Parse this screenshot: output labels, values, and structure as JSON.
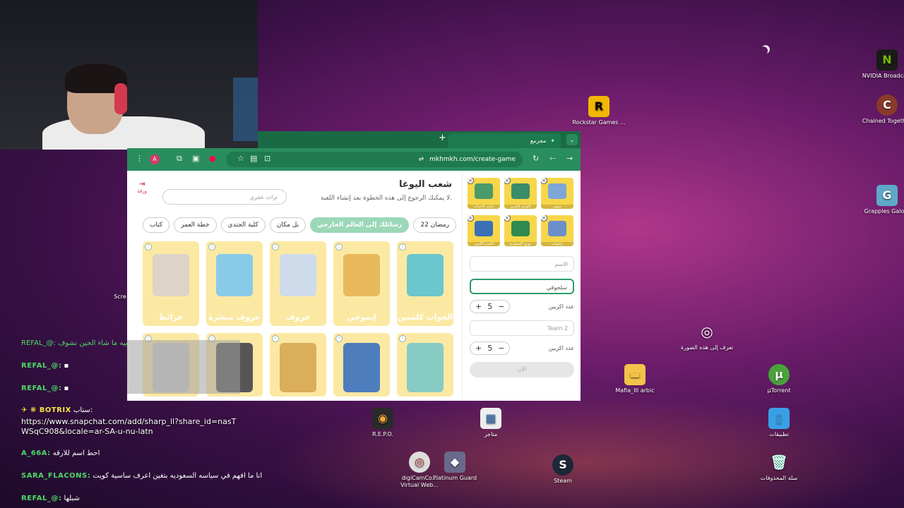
{
  "desktop": {
    "icons": [
      {
        "name": "rockstar",
        "label": "Rockstar Games ...",
        "icon": "R"
      },
      {
        "name": "nvidia",
        "label": "NVIDIA Broadcast",
        "icon": "N"
      },
      {
        "name": "chained",
        "label": "Chained Together",
        "icon": "C"
      },
      {
        "name": "grapples",
        "label": "Grapples Galore",
        "icon": "G"
      },
      {
        "name": "identify",
        "label": "تعرف إلى هذه الصورة",
        "icon": "◎"
      },
      {
        "name": "mafia",
        "label": "Mafia_III arbic",
        "icon": "▬"
      },
      {
        "name": "utorrent",
        "label": "µTorrent",
        "icon": "µ"
      },
      {
        "name": "repo",
        "label": "R.E.P.O.",
        "icon": "◉"
      },
      {
        "name": "store",
        "label": "متاجر",
        "icon": "▦"
      },
      {
        "name": "apps",
        "label": "تطبيقات",
        "icon": "▯"
      },
      {
        "name": "digicam",
        "label": "digiCamCo... Virtual Web...",
        "icon": "◎"
      },
      {
        "name": "platinum",
        "label": "Platinum Guard",
        "icon": "◆"
      },
      {
        "name": "steam",
        "label": "Steam",
        "icon": "S"
      },
      {
        "name": "recycle",
        "label": "سلة المحذوفات",
        "icon": "🗑"
      },
      {
        "name": "scre",
        "label": "Scre",
        "icon": ""
      }
    ]
  },
  "chat": [
    {
      "user": "REFAL_@:",
      "text": "",
      "color": "#4cd964"
    },
    {
      "user": "REFAL_@:",
      "text": "",
      "color": "#4cd964"
    },
    {
      "user": "✈ ❋ BOTRIX",
      "text": "سناب:",
      "color": "#f5e642"
    },
    {
      "user": "A_66A:",
      "text": "احط اسم للارقه",
      "color": "#4cd964"
    },
    {
      "user": "SARA_FLACONS:",
      "text": "انا ما افهم في سياسه السعوديه بتغين اعرف ساسية كويت",
      "color": "#4cd964"
    },
    {
      "user": "REFAL_@:",
      "text": "شبلها",
      "color": "#4cd964"
    }
  ],
  "chat_link": "https://www.snapchat.com/add/sharp_ll?share_id=nasTWSqC908&locale=ar-SA-u-nu-latn",
  "chat_top_text": "REFAL_@: سعوديه حصو هوبيه ما شاء الحين نشوف",
  "browser": {
    "tab_title": "مجرمع",
    "url": "mkhmkh.com/create-game",
    "avatar": "A"
  },
  "page": {
    "title": "شعب اليوغا",
    "subtitle": "لا يمكنك الرجوع إلى هذه الخطوة بعد إنشاء اللعبة.",
    "search_placeholder": "تراث عجري",
    "side_label": "ورقة",
    "chips": [
      "رمضان 22",
      "رسائلك إلى العالم الخارجي",
      "بل مكان",
      "كلية الجندي",
      "خطة العمر",
      "كتاب"
    ],
    "selected_chip": 1,
    "cards_row1": [
      {
        "name": "الجواب كلمتين",
        "color": "#5bc0c8"
      },
      {
        "name": "إيموجي",
        "color": "#e6b24a"
      },
      {
        "name": "حروف",
        "color": "#c8d8e8"
      },
      {
        "name": "حروف مبعثرة",
        "color": "#7cc6e6"
      },
      {
        "name": "خرائط",
        "color": "#d9d0c0"
      }
    ],
    "cards_row2": [
      {
        "name": "",
        "color": "#7cc6bf"
      },
      {
        "name": "",
        "color": "#3b6fb6"
      },
      {
        "name": "",
        "color": "#d8a64a"
      },
      {
        "name": "",
        "color": "#444444"
      },
      {
        "name": "",
        "color": "#c9c9c9"
      }
    ],
    "selected_cats": [
      {
        "label": "جيوف",
        "color": "#7ea6d6"
      },
      {
        "label": "القرآن الكريم",
        "color": "#3a8c6a"
      },
      {
        "label": "رايات الاحداث",
        "color": "#4a9a6a"
      },
      {
        "label": "رياضيات",
        "color": "#6b8fc9"
      },
      {
        "label": "دوري السعودية",
        "color": "#2f8a4f"
      },
      {
        "label": "المدن الكبرى",
        "color": "#3b6fb6"
      }
    ],
    "name_placeholder": "الاسم",
    "team1_value": "سلجوقي",
    "team1_players_label": "عدد اكربين",
    "team1_players": "5",
    "team2_placeholder": "Team 2",
    "team2_players_label": "عدد اكربين",
    "team2_players": "5",
    "go_label": "الآن"
  }
}
